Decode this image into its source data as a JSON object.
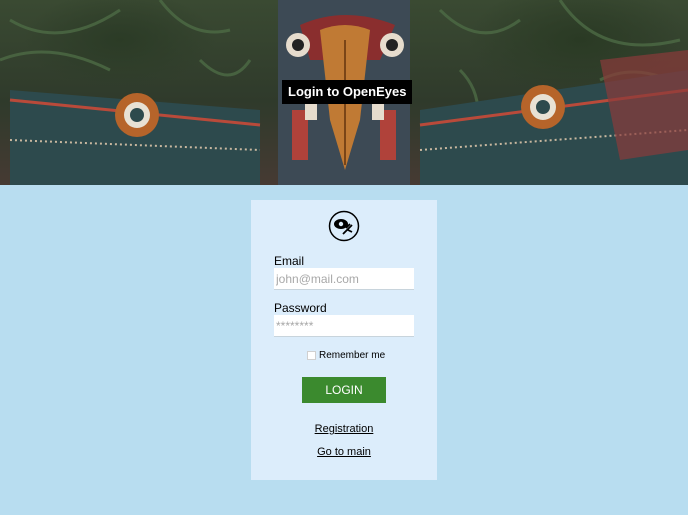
{
  "hero": {
    "title": "Login to OpenEyes"
  },
  "form": {
    "email_label": "Email",
    "email_placeholder": "john@mail.com",
    "password_label": "Password",
    "password_placeholder": "********",
    "remember_label": "Remember me",
    "login_label": "LOGIN"
  },
  "links": {
    "registration": "Registration",
    "go_main": "Go to main"
  },
  "colors": {
    "background": "#b8ddf0",
    "card": "#dcedfb",
    "button": "#3b8a2e"
  }
}
